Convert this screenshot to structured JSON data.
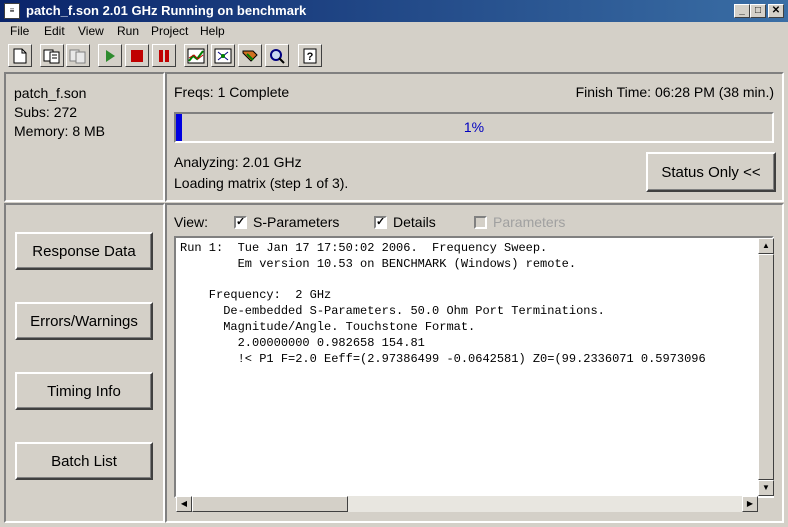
{
  "window": {
    "title": "patch_f.son  2.01 GHz Running on benchmark",
    "icon": "app-icon",
    "controls": [
      "minimize",
      "maximize",
      "close"
    ]
  },
  "menu": [
    "File",
    "Edit",
    "View",
    "Run",
    "Project",
    "Help"
  ],
  "toolbar": [
    "new-doc-icon",
    "copy-icon",
    "paste-icon",
    "play-icon",
    "stop-icon",
    "pause-icon",
    "graph-icon",
    "geometry-icon",
    "params-icon",
    "zoom-icon",
    "help-icon"
  ],
  "project": {
    "file": "patch_f.son",
    "subs": "Subs: 272",
    "memory": "Memory: 8 MB"
  },
  "status": {
    "freqs": "Freqs:  1 Complete",
    "finish": "Finish Time:  06:28 PM (38 min.)",
    "progress_label": "1%",
    "progress_value": 0.01,
    "analyzing": "Analyzing:  2.01 GHz",
    "loading": "Loading matrix (step 1 of 3).",
    "status_only_button": "Status Only <<"
  },
  "side_buttons": {
    "response": "Response Data",
    "errors": "Errors/Warnings",
    "timing": "Timing Info",
    "batch": "Batch List"
  },
  "view": {
    "label": "View:",
    "options": [
      {
        "label": "S-Parameters",
        "checked": true,
        "enabled": true
      },
      {
        "label": "Details",
        "checked": true,
        "enabled": true
      },
      {
        "label": "Parameters",
        "checked": false,
        "enabled": false
      }
    ]
  },
  "output_text": "Run 1:  Tue Jan 17 17:50:02 2006.  Frequency Sweep.\n        Em version 10.53 on BENCHMARK (Windows) remote.\n\n    Frequency:  2 GHz\n      De-embedded S-Parameters. 50.0 Ohm Port Terminations.\n      Magnitude/Angle. Touchstone Format.\n        2.00000000 0.982658 154.81\n        !< P1 F=2.0 Eeff=(2.97386499 -0.0642581) Z0=(99.2336071 0.5973096"
}
